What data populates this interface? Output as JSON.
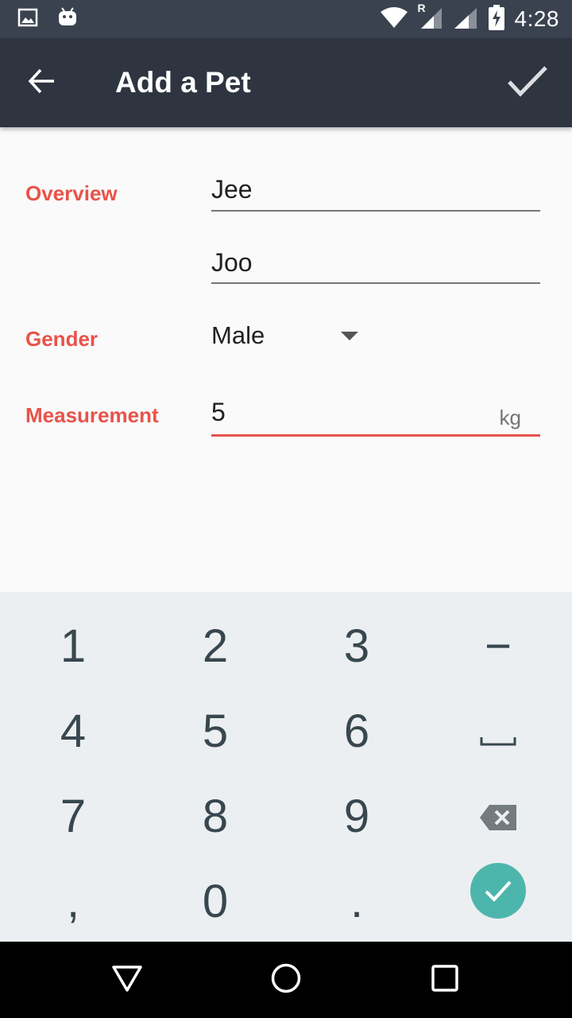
{
  "status_bar": {
    "time": "4:28",
    "network_badge": "R",
    "icons": [
      "image-notification-icon",
      "android-notification-icon",
      "wifi-icon",
      "signal-roaming-icon",
      "signal-icon",
      "battery-charging-icon"
    ]
  },
  "toolbar": {
    "title": "Add a Pet",
    "back_icon": "arrow-back-icon",
    "done_icon": "check-icon"
  },
  "form": {
    "overview_label": "Overview",
    "name_first": "Jee",
    "name_second": "Joo",
    "gender_label": "Gender",
    "gender_value": "Male",
    "measurement_label": "Measurement",
    "measurement_value": "5",
    "measurement_unit": "kg"
  },
  "keyboard": {
    "keys": [
      "1",
      "2",
      "3",
      "−",
      "4",
      "5",
      "6",
      "space",
      "7",
      "8",
      "9",
      "backspace",
      ",",
      "0",
      ".",
      "done"
    ],
    "accent_color": "#4db6ac"
  },
  "nav_bar": {
    "buttons": [
      "back-triangle-icon",
      "home-circle-icon",
      "recents-square-icon"
    ]
  },
  "colors": {
    "status_bar": "#3a4250",
    "toolbar": "#2e3440",
    "label_accent": "#e8534a",
    "keyboard_bg": "#eceff1",
    "key_text": "#37474f"
  }
}
